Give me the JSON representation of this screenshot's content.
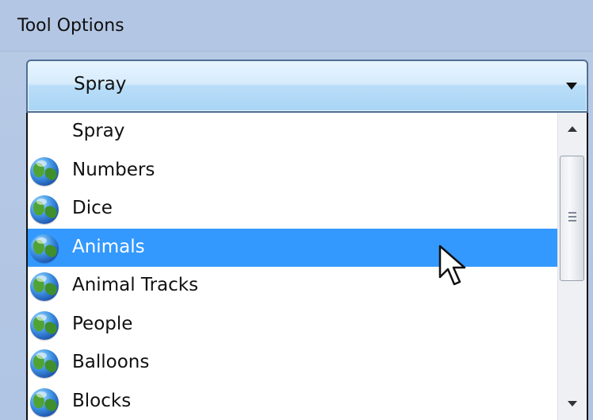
{
  "header": {
    "title": "Tool Options"
  },
  "combo": {
    "value": "Spray"
  },
  "list": {
    "items": [
      {
        "label": "Spray",
        "icon": "none"
      },
      {
        "label": "Numbers",
        "icon": "globe-icon"
      },
      {
        "label": "Dice",
        "icon": "globe-icon"
      },
      {
        "label": "Animals",
        "icon": "globe-icon",
        "selected": true
      },
      {
        "label": "Animal Tracks",
        "icon": "globe-icon"
      },
      {
        "label": "People",
        "icon": "globe-icon"
      },
      {
        "label": "Balloons",
        "icon": "globe-icon"
      },
      {
        "label": "Blocks",
        "icon": "globe-icon"
      }
    ]
  },
  "colors": {
    "selection": "#3399ff",
    "header_bg": "#b3c7e4"
  }
}
